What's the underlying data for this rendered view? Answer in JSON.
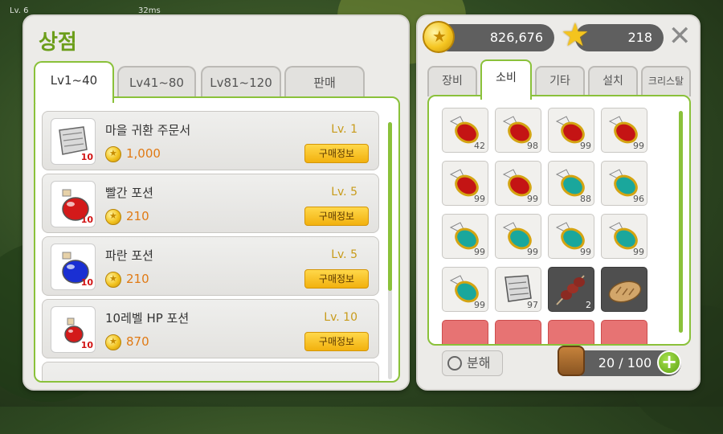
{
  "hud": {
    "level_text": "Lv. 6",
    "ping": "32ms"
  },
  "shop": {
    "title": "상점",
    "tabs": [
      "Lv1~40",
      "Lv41~80",
      "Lv81~120",
      "판매"
    ],
    "active_tab": 0,
    "items": [
      {
        "name": "마을 귀환 주문서",
        "level": "Lv. 1",
        "price": "1,000",
        "qty": "10",
        "buy_label": "구매정보",
        "icon": "scroll-icon"
      },
      {
        "name": "빨간 포션",
        "level": "Lv. 5",
        "price": "210",
        "qty": "10",
        "buy_label": "구매정보",
        "icon": "red-potion-icon"
      },
      {
        "name": "파란 포션",
        "level": "Lv. 5",
        "price": "210",
        "qty": "10",
        "buy_label": "구매정보",
        "icon": "blue-potion-icon"
      },
      {
        "name": "10레벨 HP 포션",
        "level": "Lv. 10",
        "price": "870",
        "qty": "10",
        "buy_label": "구매정보",
        "icon": "hp-potion-icon"
      }
    ]
  },
  "inventory": {
    "meso": "826,676",
    "stars": "218",
    "tabs": [
      "장비",
      "소비",
      "기타",
      "설치",
      "크리스탈"
    ],
    "active_tab": 1,
    "slots": [
      {
        "icon": "red-potion-icon",
        "qty": "42"
      },
      {
        "icon": "red-potion-icon",
        "qty": "98"
      },
      {
        "icon": "red-potion-icon",
        "qty": "99"
      },
      {
        "icon": "red-potion-icon",
        "qty": "99"
      },
      {
        "icon": "red-potion-icon",
        "qty": "99"
      },
      {
        "icon": "red-potion-icon",
        "qty": "99"
      },
      {
        "icon": "teal-potion-icon",
        "qty": "88"
      },
      {
        "icon": "teal-potion-icon",
        "qty": "96"
      },
      {
        "icon": "teal-potion-icon",
        "qty": "99"
      },
      {
        "icon": "teal-potion-icon",
        "qty": "99"
      },
      {
        "icon": "teal-potion-icon",
        "qty": "99"
      },
      {
        "icon": "teal-potion-icon",
        "qty": "99"
      },
      {
        "icon": "teal-potion-icon",
        "qty": "99"
      },
      {
        "icon": "scroll-icon",
        "qty": "97"
      },
      {
        "icon": "skewer-icon",
        "qty": "2"
      },
      {
        "icon": "bread-icon",
        "qty": ""
      }
    ],
    "disassemble_label": "분해",
    "capacity": "20 / 100",
    "add_label": "+"
  },
  "colors": {
    "accent": "#8ac13a",
    "title": "#6c9e1a",
    "price": "#e07a14",
    "level": "#c89b1a",
    "buy": "#f2b10e"
  }
}
